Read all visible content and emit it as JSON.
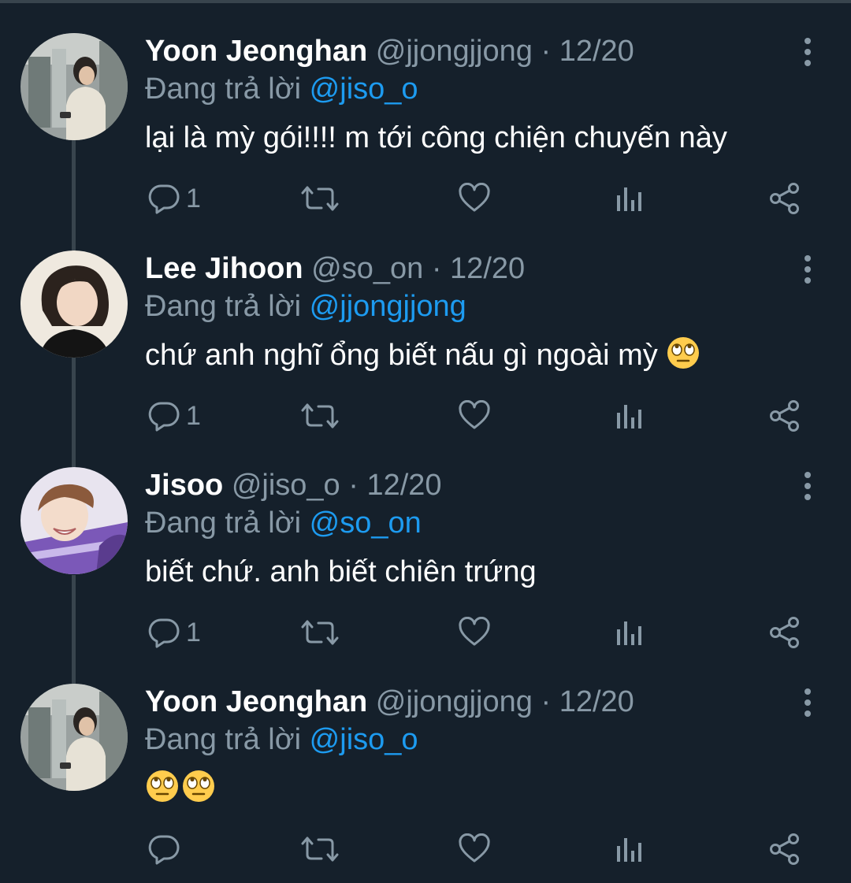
{
  "tweets": [
    {
      "name": "Yoon Jeonghan",
      "handle": "@jjongjjong",
      "date": "12/20",
      "replying_prefix": "Đang trả lời",
      "replying_to": "@jiso_o",
      "text": "lại là mỳ gói!!!! m tới công chiện chuyến này",
      "emoji_count": 0,
      "reply_count": "1",
      "avatar_icon": "person-photo-icon"
    },
    {
      "name": "Lee Jihoon",
      "handle": "@so_on",
      "date": "12/20",
      "replying_prefix": "Đang trả lời",
      "replying_to": "@jjongjjong",
      "text": "chứ anh nghĩ ổng biết nấu gì ngoài mỳ",
      "emoji_count": 1,
      "reply_count": "1",
      "avatar_icon": "person-photo-icon"
    },
    {
      "name": "Jisoo",
      "handle": "@jiso_o",
      "date": "12/20",
      "replying_prefix": "Đang trả lời",
      "replying_to": "@so_on",
      "text": "biết chứ. anh biết chiên trứng",
      "emoji_count": 0,
      "reply_count": "1",
      "avatar_icon": "person-photo-icon"
    },
    {
      "name": "Yoon Jeonghan",
      "handle": "@jjongjjong",
      "date": "12/20",
      "replying_prefix": "Đang trả lời",
      "replying_to": "@jiso_o",
      "text": "",
      "emoji_count": 2,
      "reply_count": "",
      "avatar_icon": "person-photo-icon"
    }
  ],
  "emoji": "eye-roll-emoji",
  "icons": {
    "reply": "reply-icon",
    "retweet": "retweet-icon",
    "like": "heart-icon",
    "analytics": "analytics-icon",
    "share": "share-icon",
    "menu": "more-vertical-icon"
  },
  "colors": {
    "background": "#15202b",
    "text": "#ffffff",
    "secondary": "#8899a6",
    "mention": "#1d9bf0",
    "thread_line": "#38444d"
  }
}
